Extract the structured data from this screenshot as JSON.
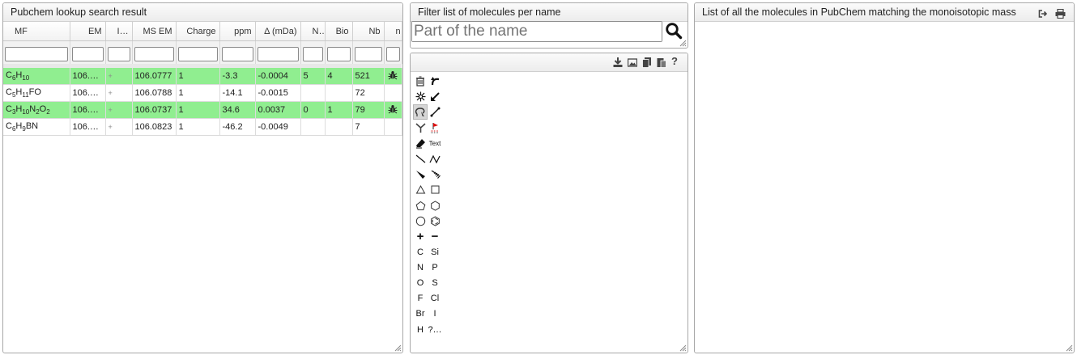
{
  "pubchem_panel": {
    "title": "Pubchem lookup search result",
    "columns": [
      "MF",
      "EM",
      "Ioni…",
      "MS EM",
      "Charge",
      "ppm",
      "Δ (mDa)",
      "Nat",
      "Bio",
      "Nb",
      "n"
    ],
    "rows": [
      {
        "mf_parts": [
          [
            "C",
            ""
          ],
          [
            "6",
            "sub"
          ],
          [
            "H",
            ""
          ],
          [
            "10",
            "sub"
          ]
        ],
        "em": "106.0…",
        "ion": "+",
        "msem": "106.0777",
        "charge": "1",
        "ppm": "-3.3",
        "delta": "-0.0004",
        "nat": "5",
        "bio": "4",
        "nb": "521",
        "has_icon": true,
        "highlight": true
      },
      {
        "mf_parts": [
          [
            "C",
            ""
          ],
          [
            "5",
            "sub"
          ],
          [
            "H",
            ""
          ],
          [
            "11",
            "sub"
          ],
          [
            "FO",
            ""
          ]
        ],
        "em": "106.0…",
        "ion": "+",
        "msem": "106.0788",
        "charge": "1",
        "ppm": "-14.1",
        "delta": "-0.0015",
        "nat": "",
        "bio": "",
        "nb": "72",
        "has_icon": false,
        "highlight": false
      },
      {
        "mf_parts": [
          [
            "C",
            ""
          ],
          [
            "3",
            "sub"
          ],
          [
            "H",
            ""
          ],
          [
            "10",
            "sub"
          ],
          [
            "N",
            ""
          ],
          [
            "2",
            "sub"
          ],
          [
            "O",
            ""
          ],
          [
            "2",
            "sub"
          ]
        ],
        "em": "106.0…",
        "ion": "+",
        "msem": "106.0737",
        "charge": "1",
        "ppm": "34.6",
        "delta": "0.0037",
        "nat": "0",
        "bio": "1",
        "nb": "79",
        "has_icon": true,
        "highlight": true
      },
      {
        "mf_parts": [
          [
            "C",
            ""
          ],
          [
            "6",
            "sub"
          ],
          [
            "H",
            ""
          ],
          [
            "9",
            "sub"
          ],
          [
            "BN",
            ""
          ]
        ],
        "em": "106.0…",
        "ion": "+",
        "msem": "106.0823",
        "charge": "1",
        "ppm": "-46.2",
        "delta": "-0.0049",
        "nat": "",
        "bio": "",
        "nb": "7",
        "has_icon": false,
        "highlight": false
      }
    ]
  },
  "filter_panel": {
    "title": "Filter list of molecules per name",
    "search_placeholder": "Part of the name"
  },
  "editor_panel": {
    "toolbar_icons": [
      "download-icon",
      "image-icon",
      "copy-icon",
      "paste-icon",
      "help-icon"
    ],
    "help_label": "?",
    "palette": [
      [
        "trash-icon",
        "undo-icon"
      ],
      [
        "zoom-icon",
        "resize-icon"
      ],
      [
        "lasso-icon",
        "line-tool-icon"
      ],
      [
        "fork-icon",
        "pin-icon"
      ],
      [
        "eraser-icon",
        "Text"
      ],
      [
        "bond-single-icon",
        "bond-chain-icon"
      ],
      [
        "wedge-bold-icon",
        "wedge-hash-icon"
      ],
      [
        "ring-3-icon",
        "ring-4-icon"
      ],
      [
        "ring-5-icon",
        "ring-6-icon"
      ],
      [
        "ring-7-icon",
        "benzene-icon"
      ],
      [
        "+",
        "−"
      ],
      [
        "C",
        "Si"
      ],
      [
        "N",
        "P"
      ],
      [
        "O",
        "S"
      ],
      [
        "F",
        "Cl"
      ],
      [
        "Br",
        "I"
      ],
      [
        "H",
        "?…"
      ]
    ]
  },
  "right_panel": {
    "title": "List of all the molecules in PubChem matching the monoisotopic mass"
  }
}
